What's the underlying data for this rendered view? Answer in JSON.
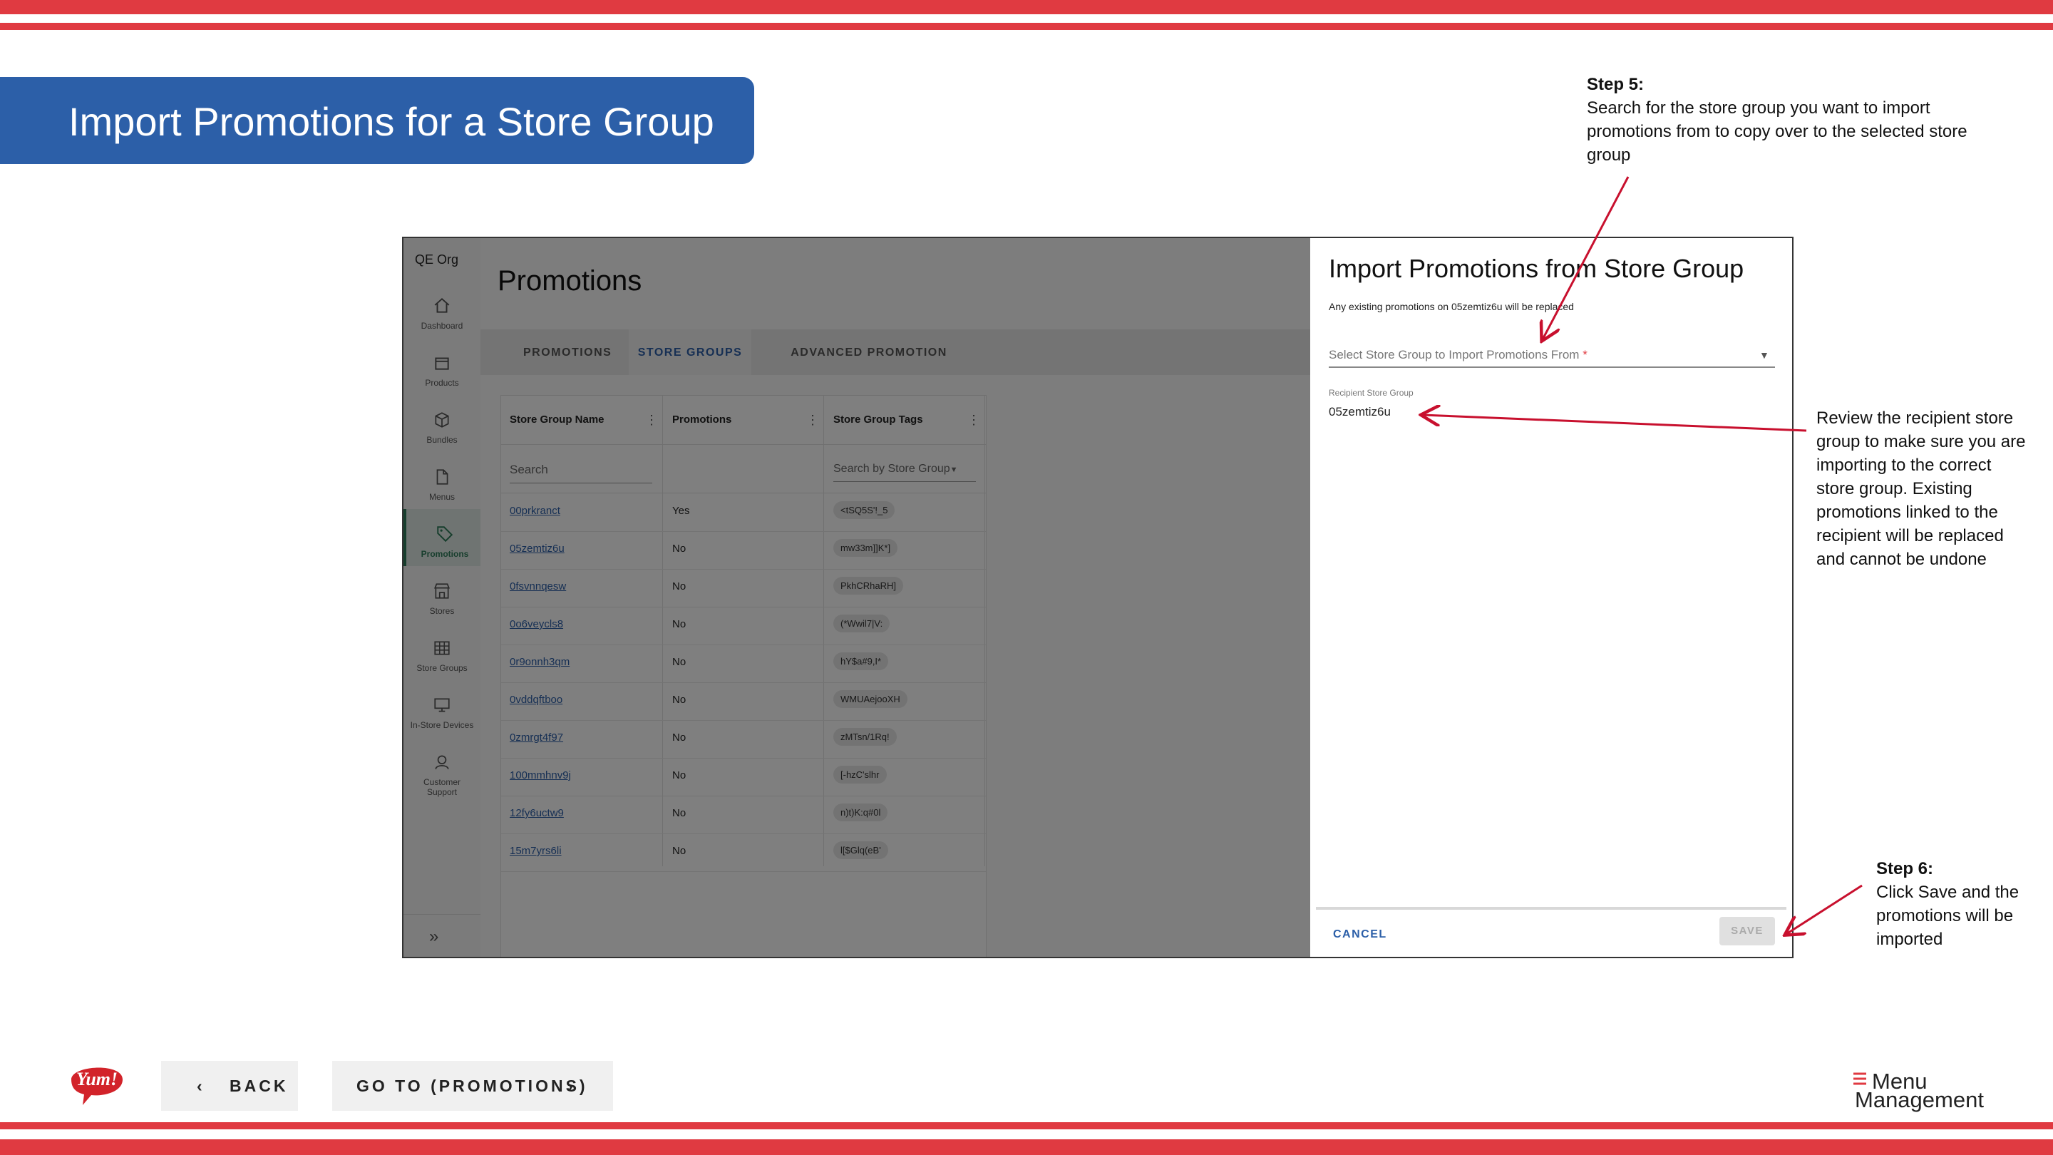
{
  "slide": {
    "title": "Import Promotions for a Store Group",
    "colors": {
      "accent_red": "#e03a41",
      "banner_blue": "#2c5fa8"
    }
  },
  "app": {
    "org": "QE Org",
    "nav": [
      {
        "label": "Dashboard",
        "icon": "home-icon"
      },
      {
        "label": "Products",
        "icon": "box-icon"
      },
      {
        "label": "Bundles",
        "icon": "cube-icon"
      },
      {
        "label": "Menus",
        "icon": "document-icon"
      },
      {
        "label": "Promotions",
        "icon": "tag-icon"
      },
      {
        "label": "Stores",
        "icon": "store-icon"
      },
      {
        "label": "Store Groups",
        "icon": "grid-icon"
      },
      {
        "label": "In-Store Devices",
        "icon": "monitor-icon"
      },
      {
        "label": "Customer Support",
        "icon": "support-icon"
      }
    ],
    "page_title": "Promotions",
    "tabs": [
      "PROMOTIONS",
      "STORE GROUPS",
      "ADVANCED PROMOTION SEARCH"
    ],
    "table": {
      "headers": [
        "Store Group Name",
        "Promotions",
        "Store Group Tags"
      ],
      "filter_name_placeholder": "Search",
      "filter_tags_placeholder": "Search by Store Group",
      "rows": [
        {
          "name": "00prkranct",
          "promotions": "Yes",
          "tag": "<tSQ5S'!_5"
        },
        {
          "name": "05zemtiz6u",
          "promotions": "No",
          "tag": "mw33m]]K*]"
        },
        {
          "name": "0fsvnnqesw",
          "promotions": "No",
          "tag": "PkhCRhaRH]"
        },
        {
          "name": "0o6veycls8",
          "promotions": "No",
          "tag": "(*Wwil7|V:"
        },
        {
          "name": "0r9onnh3qm",
          "promotions": "No",
          "tag": "hY$a#9,I*"
        },
        {
          "name": "0vddqftboo",
          "promotions": "No",
          "tag": "WMUAejooXH"
        },
        {
          "name": "0zmrgt4f97",
          "promotions": "No",
          "tag": "zMTsn/1Rq!"
        },
        {
          "name": "100mmhnv9j",
          "promotions": "No",
          "tag": "[-hzC'slhr"
        },
        {
          "name": "12fy6uctw9",
          "promotions": "No",
          "tag": "n)t)K:q#0l"
        },
        {
          "name": "15m7yrs6li",
          "promotions": "No",
          "tag": "l[$Glq(eB'"
        }
      ]
    }
  },
  "modal": {
    "title": "Import Promotions from Store Group",
    "subtitle": "Any existing promotions on 05zemtiz6u will be replaced",
    "select_placeholder": "Select Store Group to Import Promotions From",
    "required_mark": "*",
    "recipient_label": "Recipient Store Group",
    "recipient_value": "05zemtiz6u",
    "cancel_label": "CANCEL",
    "save_label": "SAVE"
  },
  "notes": {
    "step5_title": "Step 5:",
    "step5_lines": [
      "Search for the store group you want to import",
      "promotions from to copy over to the selected store",
      "group"
    ],
    "review_lines": [
      "Review the recipient store",
      "group to make sure you are",
      "importing to the correct",
      "store group. Existing",
      "promotions linked to the",
      "recipient will be replaced",
      "and cannot be undone"
    ],
    "step6_title": "Step 6:",
    "step6_lines": [
      "Click Save and the",
      "promotions will be",
      "imported"
    ]
  },
  "footer": {
    "back_label": "BACK",
    "goto_label": "GO TO (PROMOTIONS)",
    "yum_logo_text": "Yum!",
    "mm_logo_line1": "Menu",
    "mm_logo_line2": "Management"
  }
}
